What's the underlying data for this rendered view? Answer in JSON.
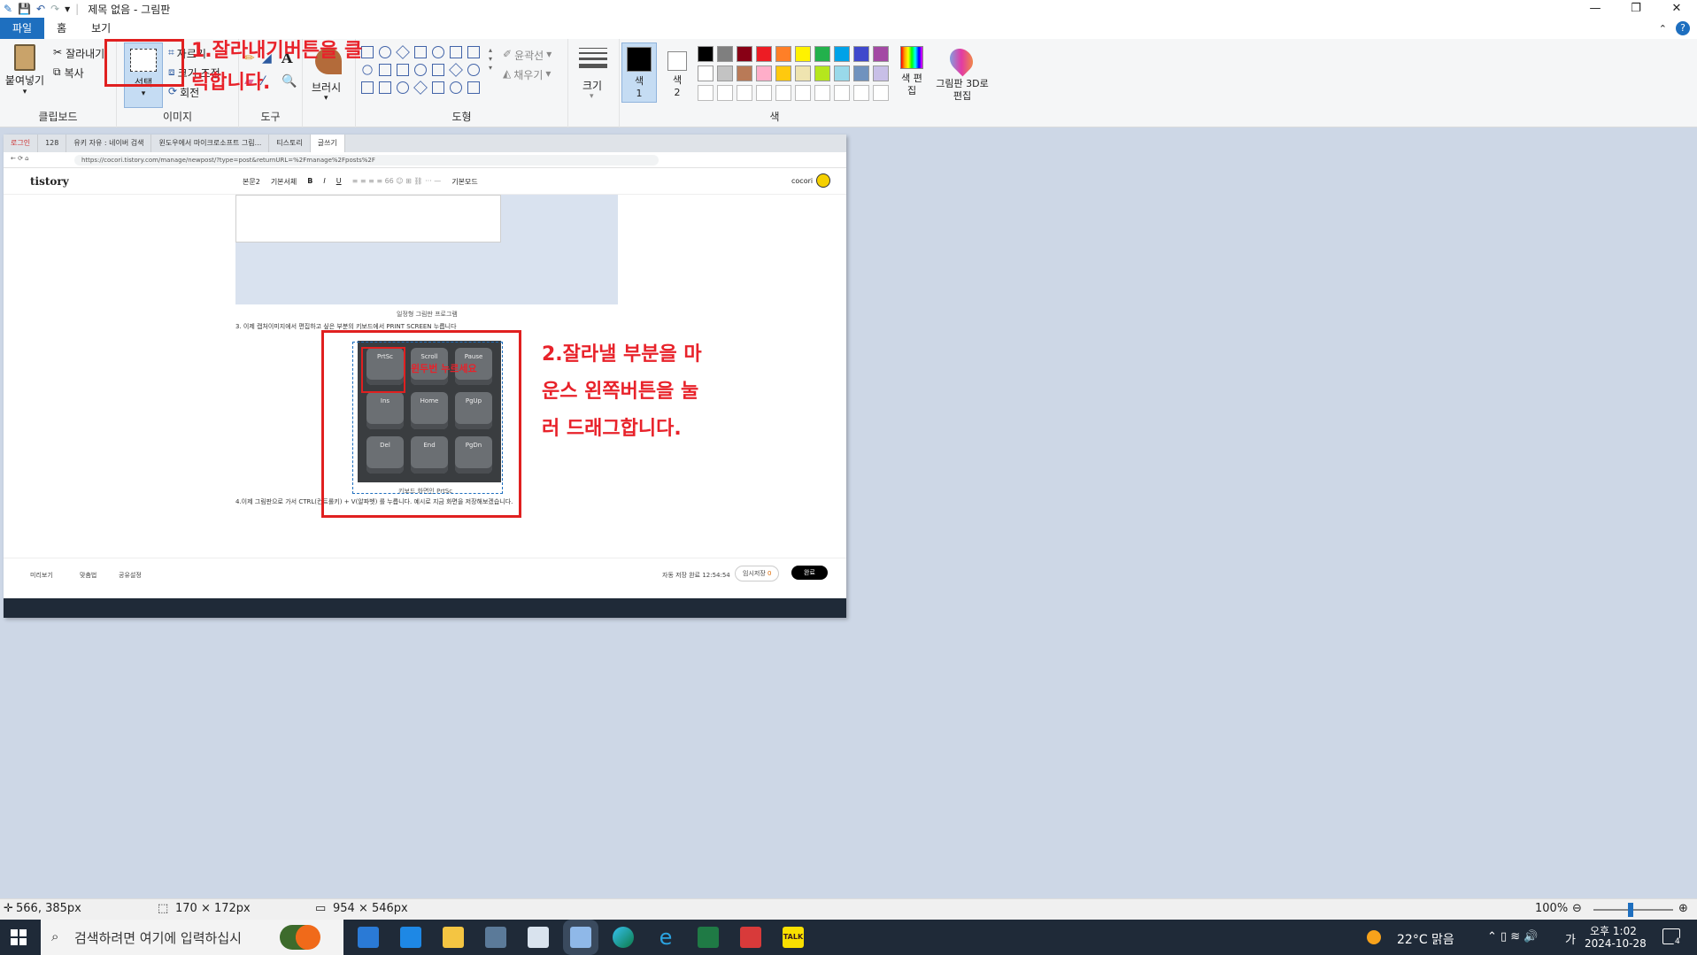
{
  "app": {
    "title": "제목 없음 - 그림판",
    "tabs": [
      "파일",
      "홈",
      "보기"
    ]
  },
  "ribbon": {
    "clipboard": {
      "paste": "붙여넣기",
      "cut": "잘라내기",
      "copy": "복사",
      "label": "클립보드"
    },
    "image": {
      "select": "선택",
      "crop": "자르기",
      "resize": "크기 조정",
      "rotate": "회전",
      "label": "이미지"
    },
    "tools": {
      "label": "도구"
    },
    "brushes": {
      "label": "브러시"
    },
    "shapes": {
      "outline": "윤곽선",
      "fill": "채우기",
      "label": "도형"
    },
    "size": {
      "label": "크기"
    },
    "colors": {
      "color1": "색 1",
      "color2": "색 2",
      "edit": "색 편집",
      "paint3d": "그림판 3D로 편집",
      "label": "색",
      "palette": [
        "#000000",
        "#7f7f7f",
        "#880015",
        "#ed1c24",
        "#ff7f27",
        "#fff200",
        "#22b14c",
        "#00a2e8",
        "#3f48cc",
        "#a349a4",
        "#ffffff",
        "#c3c3c3",
        "#b97a57",
        "#ffaec9",
        "#ffc90e",
        "#efe4b0",
        "#b5e61d",
        "#99d9ea",
        "#7092be",
        "#c8bfe7"
      ]
    }
  },
  "browser": {
    "tabs": [
      "로그인",
      "128",
      "유키 자유 : 네이버 검색",
      "윈도우에서 마이크로소프트 그림...",
      "티스토리",
      "글쓰기"
    ],
    "url": "https://cocori.tistory.com/manage/newpost/?type=post&returnURL=%2Fmanage%2Fposts%2F",
    "logo": "tistory",
    "user": "cocori",
    "toolbar_items": [
      "본문2",
      "기본서체",
      "B",
      "I",
      "U",
      "기본모드"
    ],
    "caption1": "일정형 그림판 프로그램",
    "step3": "3. 이제 캡처이미지에서 편집하고 싶은 부분의 키보드에서 PRINT SCREEN 누릅니다",
    "caption2": "키보드 화면인 PrtSc",
    "step4": "4.이제 그림판으로 가서 CTRL(컨트롤키) + V(알파벳) 를 누릅니다. 예시로 지금 화면을 저장해보겠습니다.",
    "keys": [
      "PrtSc",
      "Scroll",
      "Pause",
      "Ins",
      "Home",
      "PgUp",
      "Del",
      "End",
      "PgDn"
    ],
    "inner_label": "윈두번 누르세요",
    "footer": {
      "preview": "미리보기",
      "spell": "맞춤법",
      "publish_setting": "공유설정",
      "autosave": "자동 저장 완료 12:54:54",
      "temp": "임시저장",
      "temp_count": "0",
      "done": "완료"
    }
  },
  "annotations": {
    "step1": "1.잘라내기버튼을 클릭합니다.",
    "step1_line1": "1.잘라내기버튼을 클",
    "step1_line2": "릭합니다.",
    "step2_line1": "2.잘라낼 부분을 마",
    "step2_line2": "운스 왼쪽버튼을 눌",
    "step2_line3": "러 드래그합니다."
  },
  "status": {
    "cursor": "566, 385px",
    "selection": "170 × 172px",
    "canvas_size": "954 × 546px",
    "zoom": "100%"
  },
  "taskbar": {
    "search_placeholder": "검색하려면 여기에 입력하십시",
    "weather": "22°C 맑음",
    "ime": "가",
    "time": "오후 1:02",
    "date": "2024-10-28",
    "notif": "4"
  }
}
